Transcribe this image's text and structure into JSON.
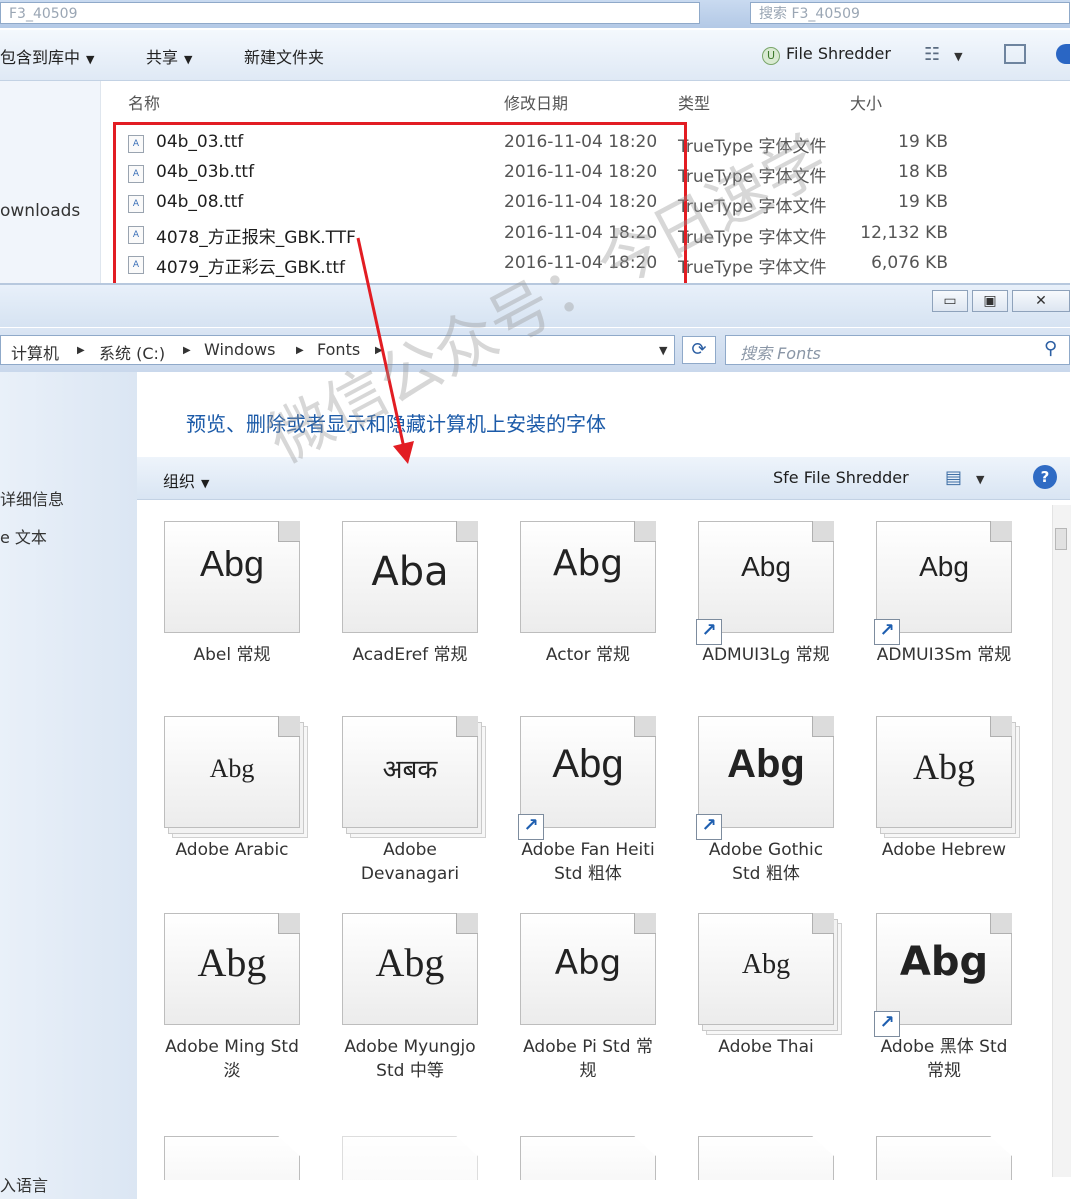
{
  "top_window": {
    "address_text": "F3_40509",
    "search_placeholder": "搜索 F3_40509",
    "toolbar": {
      "include_label": "包含到库中",
      "share_label": "共享",
      "new_folder_label": "新建文件夹",
      "file_shredder_label": "File Shredder"
    },
    "nav_item": "ownloads",
    "columns": {
      "name": "名称",
      "date": "修改日期",
      "type": "类型",
      "size": "大小"
    },
    "files": [
      {
        "name": "04b_03.ttf",
        "date": "2016-11-04 18:20",
        "type": "TrueType 字体文件",
        "size": "19 KB"
      },
      {
        "name": "04b_03b.ttf",
        "date": "2016-11-04 18:20",
        "type": "TrueType 字体文件",
        "size": "18 KB"
      },
      {
        "name": "04b_08.ttf",
        "date": "2016-11-04 18:20",
        "type": "TrueType 字体文件",
        "size": "19 KB"
      },
      {
        "name": "4078_方正报宋_GBK.TTF",
        "date": "2016-11-04 18:20",
        "type": "TrueType 字体文件",
        "size": "12,132 KB"
      },
      {
        "name": "4079_方正彩云_GBK.ttf",
        "date": "2016-11-04 18:20",
        "type": "TrueType 字体文件",
        "size": "6,076 KB"
      }
    ],
    "highlight_color": "#e21d23"
  },
  "fonts_window": {
    "breadcrumb": [
      "计算机",
      "系统 (C:)",
      "Windows",
      "Fonts"
    ],
    "search_placeholder": "搜索 Fonts",
    "header": "预览、删除或者显示和隐藏计算机上安装的字体",
    "toolbar": {
      "organize_label": "组织",
      "file_shredder_label": "Sfe File Shredder"
    },
    "sidebar": [
      "详细信息",
      "e 文本",
      "入语言"
    ],
    "tiles": [
      {
        "label": "Abel 常规",
        "sample": "Abg"
      },
      {
        "label": "AcadEref 常规",
        "sample": "Aba"
      },
      {
        "label": "Actor 常规",
        "sample": "Abg"
      },
      {
        "label": "ADMUI3Lg 常规",
        "sample": "Abg"
      },
      {
        "label": "ADMUI3Sm 常规",
        "sample": "Abg"
      },
      {
        "label": "Adobe Arabic",
        "sample": "Abg"
      },
      {
        "label": "Adobe Devanagari",
        "sample": "अबक"
      },
      {
        "label": "Adobe Fan Heiti Std 粗体",
        "sample": "Abg"
      },
      {
        "label": "Adobe Gothic Std 粗体",
        "sample": "Abg"
      },
      {
        "label": "Adobe Hebrew",
        "sample": "Abg"
      },
      {
        "label": "Adobe Ming Std 淡",
        "sample": "Abg"
      },
      {
        "label": "Adobe Myungjo Std 中等",
        "sample": "Abg"
      },
      {
        "label": "Adobe Pi Std 常规",
        "sample": "Abg"
      },
      {
        "label": "Adobe Thai",
        "sample": "Abg"
      },
      {
        "label": "Adobe 黑体 Std 常规",
        "sample": "Abg"
      }
    ]
  },
  "watermark": "微信公众号：今日速学",
  "arrow_color": "#e21d23"
}
